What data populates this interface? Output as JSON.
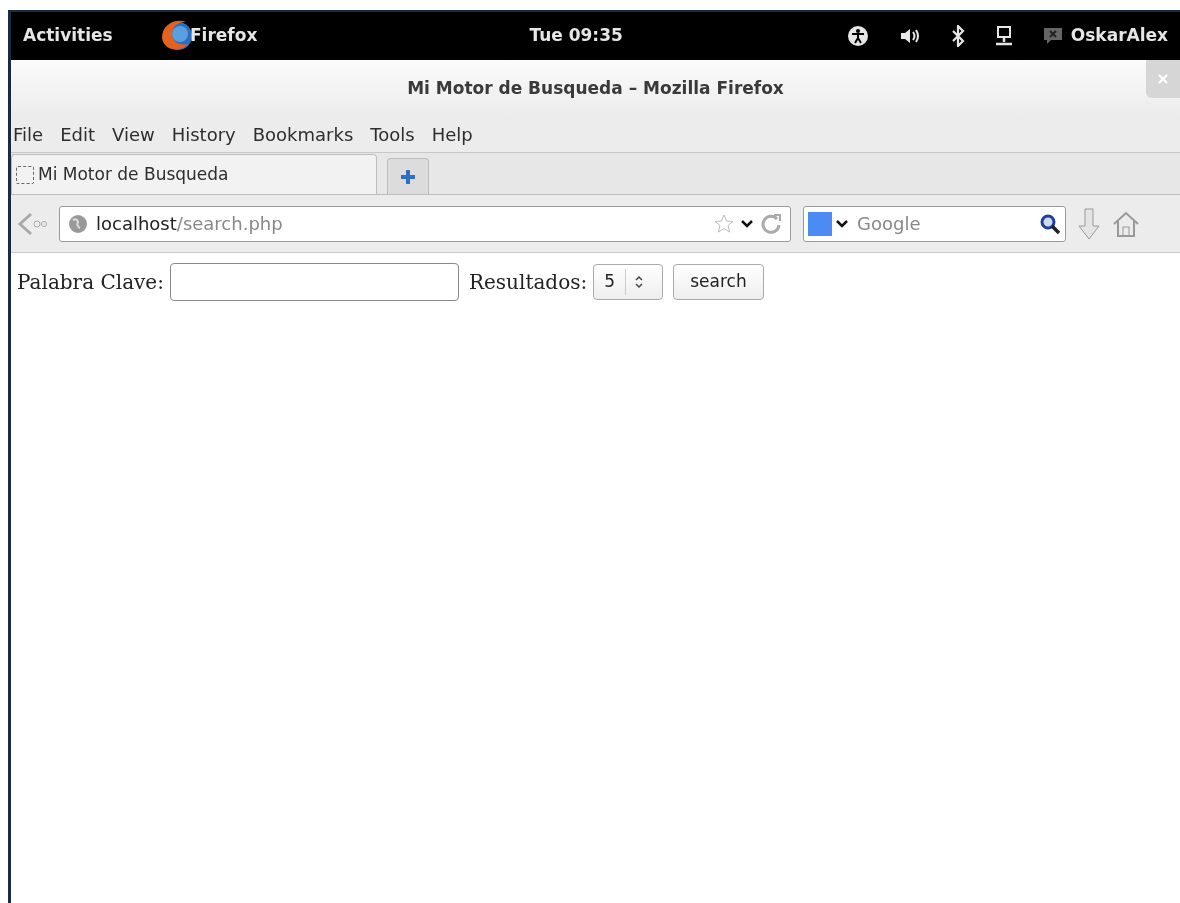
{
  "top_bar": {
    "activities": "Activities",
    "app_name": "Firefox",
    "clock": "Tue 09:35",
    "user": "OskarAlex"
  },
  "window": {
    "title": "Mi Motor de Busqueda – Mozilla Firefox"
  },
  "menu": [
    "File",
    "Edit",
    "View",
    "History",
    "Bookmarks",
    "Tools",
    "Help"
  ],
  "tabs": [
    {
      "label": "Mi Motor de Busqueda",
      "selected": true
    }
  ],
  "address_bar": {
    "host": "localhost",
    "path": "/search.php"
  },
  "search_bar": {
    "placeholder": "Google"
  },
  "page": {
    "keyword_label": "Palabra Clave:",
    "results_label": "Resultados:",
    "results_value": "5",
    "button": "search"
  }
}
